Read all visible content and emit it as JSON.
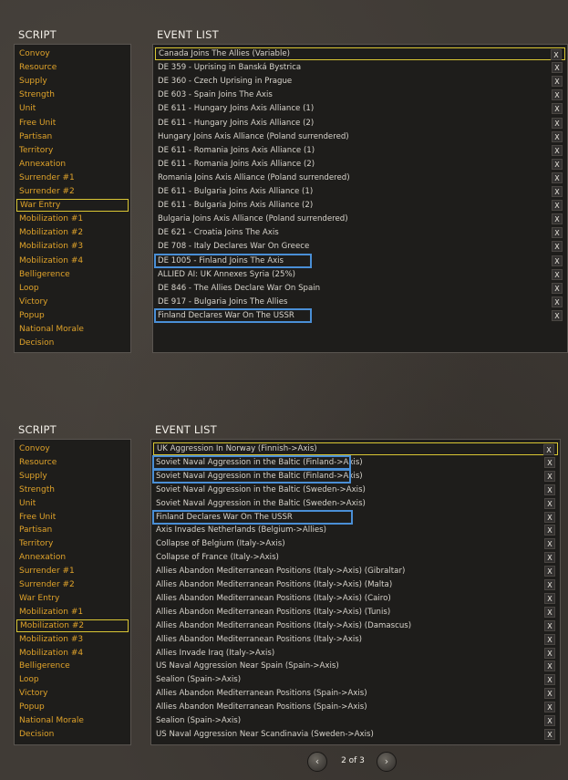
{
  "panels": [
    {
      "script_title": "SCRIPT",
      "event_title": "EVENT LIST",
      "script_items": [
        "Convoy",
        "Resource",
        "Supply",
        "Strength",
        "Unit",
        "Free Unit",
        "Partisan",
        "Territory",
        "Annexation",
        "Surrender #1",
        "Surrender #2",
        "War Entry",
        "Mobilization #1",
        "Mobilization #2",
        "Mobilization #3",
        "Mobilization #4",
        "Belligerence",
        "Loop",
        "Victory",
        "Popup",
        "National Morale",
        "Decision"
      ],
      "selected_script": 11,
      "events": [
        "Canada Joins The Allies (Variable)",
        "DE 359 - Uprising in Banská Bystrica",
        "DE 360 - Czech Uprising in Prague",
        "DE 603 - Spain Joins The Axis",
        "DE 611 - Hungary Joins Axis Alliance (1)",
        "DE 611 - Hungary Joins Axis Alliance (2)",
        "Hungary Joins Axis Alliance (Poland surrendered)",
        "DE 611 - Romania Joins Axis Alliance (1)",
        "DE 611 - Romania Joins Axis Alliance (2)",
        "Romania Joins Axis Alliance (Poland surrendered)",
        "DE 611 - Bulgaria Joins Axis Alliance (1)",
        "DE 611 - Bulgaria Joins Axis Alliance (2)",
        "Bulgaria Joins Axis Alliance (Poland surrendered)",
        "DE 621 - Croatia Joins The Axis",
        "DE 708 - Italy Declares War On Greece",
        "DE 1005 - Finland Joins The Axis",
        "ALLIED AI: UK Annexes Syria (25%)",
        "DE 846 - The Allies Declare War On Spain",
        "DE 917 - Bulgaria Joins The Allies",
        "Finland Declares War On The USSR"
      ],
      "selected_event": 0,
      "highlighted_events": [
        15,
        19
      ]
    },
    {
      "script_title": "SCRIPT",
      "event_title": "EVENT LIST",
      "script_items": [
        "Convoy",
        "Resource",
        "Supply",
        "Strength",
        "Unit",
        "Free Unit",
        "Partisan",
        "Territory",
        "Annexation",
        "Surrender #1",
        "Surrender #2",
        "War Entry",
        "Mobilization #1",
        "Mobilization #2",
        "Mobilization #3",
        "Mobilization #4",
        "Belligerence",
        "Loop",
        "Victory",
        "Popup",
        "National Morale",
        "Decision"
      ],
      "selected_script": 13,
      "events": [
        "UK Aggression In Norway (Finnish->Axis)",
        "Soviet Naval Aggression in the Baltic (Finland->Axis)",
        "Soviet Naval Aggression in the Baltic (Finland->Axis)",
        "Soviet Naval Aggression in the Baltic (Sweden->Axis)",
        "Soviet Naval Aggression in the Baltic (Sweden->Axis)",
        "Finland Declares War On The USSR",
        "Axis Invades Netherlands (Belgium->Allies)",
        "Collapse of Belgium (Italy->Axis)",
        "Collapse of France (Italy->Axis)",
        "Allies Abandon Mediterranean Positions (Italy->Axis) (Gibraltar)",
        "Allies Abandon Mediterranean Positions (Italy->Axis) (Malta)",
        "Allies Abandon Mediterranean Positions (Italy->Axis) (Cairo)",
        "Allies Abandon Mediterranean Positions (Italy->Axis) (Tunis)",
        "Allies Abandon Mediterranean Positions (Italy->Axis) (Damascus)",
        "Allies Abandon Mediterranean Positions (Italy->Axis)",
        "Allies Invade Iraq (Italy->Axis)",
        "US Naval Aggression Near Spain (Spain->Axis)",
        "Sealion (Spain->Axis)",
        "Allies Abandon Mediterranean Positions (Spain->Axis)",
        "Allies Abandon Mediterranean Positions (Spain->Axis)",
        "Sealion (Spain->Axis)",
        "US Naval Aggression Near Scandinavia (Sweden->Axis)"
      ],
      "selected_event": 0,
      "highlighted_events": [
        1,
        2,
        5
      ]
    }
  ],
  "delete_label": "X",
  "pager": {
    "text": "2 of 3",
    "prev_icon": "‹",
    "next_icon": "›"
  },
  "colors": {
    "script_text": "#e0a32a",
    "event_text": "#d8d4cc",
    "select_border": "#d9c634",
    "highlight_border": "#4a8fd6"
  }
}
